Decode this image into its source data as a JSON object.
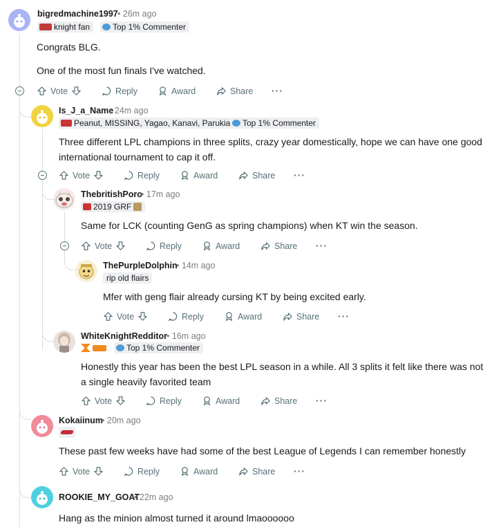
{
  "actions": {
    "vote": "Vote",
    "reply": "Reply",
    "award": "Award",
    "share": "Share"
  },
  "comments": [
    {
      "username": "bigredmachine1997",
      "time": "26m ago",
      "flairs": [
        "knight fan",
        "Top 1% Commenter"
      ],
      "body": [
        "Congrats BLG.",
        "One of the most fun finals I've watched."
      ]
    },
    {
      "username": "Is_J_a_Name",
      "time": "24m ago",
      "flairs": [
        "Peanut, MISSING, Yagao, Kanavi, Parukia",
        "Top 1% Commenter"
      ],
      "body": [
        "Three different LPL champions in three splits, crazy year domestically, hope we can have one good international tournament to cap it off."
      ]
    },
    {
      "username": "ThebritishPoro",
      "time": "17m ago",
      "flairs": [
        "2019 GRF"
      ],
      "body": [
        "Same for LCK (counting GenG as spring champions) when KT win the season."
      ]
    },
    {
      "username": "ThePurpleDolphin",
      "time": "14m ago",
      "flairs": [
        "rip old flairs"
      ],
      "body": [
        "Mfer with geng flair already cursing KT by being excited early."
      ]
    },
    {
      "username": "WhiteKnightRedditor",
      "time": "16m ago",
      "flairs": [
        "Top 1% Commenter"
      ],
      "body": [
        "Honestly this year has been the best LPL season in a while. All 3 splits it felt like there was not a single heavily favorited team"
      ]
    },
    {
      "username": "Kokaiinum",
      "time": "20m ago",
      "flairs": [],
      "body": [
        "These past few weeks have had some of the best League of Legends I can remember honestly"
      ]
    },
    {
      "username": "ROOKIE_MY_GOAT",
      "time": "22m ago",
      "flairs": [],
      "body": [
        "Hang as the minion almost turned it around lmaoooooo"
      ]
    }
  ],
  "separator": "•",
  "colors": {
    "accent_blue": "#0079d3",
    "muted": "#576f76",
    "thread": "#d9dcde"
  }
}
